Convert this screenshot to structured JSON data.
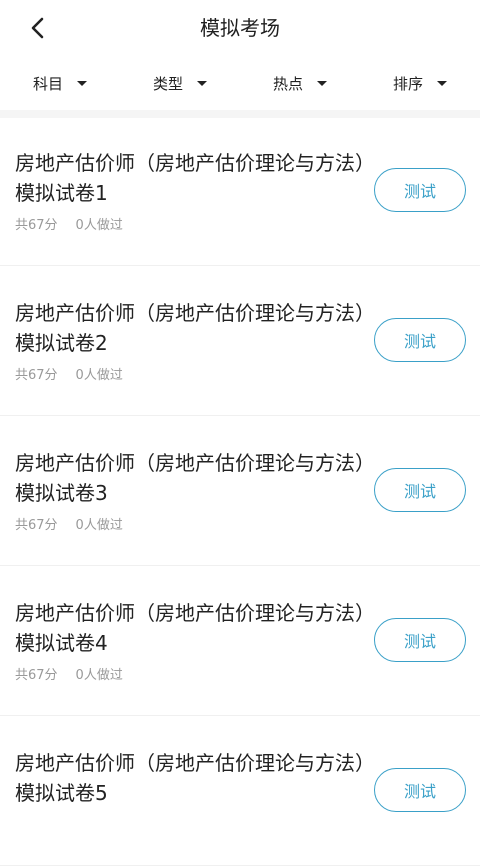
{
  "header": {
    "title": "模拟考场"
  },
  "filters": [
    {
      "label": "科目"
    },
    {
      "label": "类型"
    },
    {
      "label": "热点"
    },
    {
      "label": "排序"
    }
  ],
  "exams": [
    {
      "title": "房地产估价师（房地产估价理论与方法）模拟试卷1",
      "score": "共67分",
      "participants": "0人做过",
      "button": "测试"
    },
    {
      "title": "房地产估价师（房地产估价理论与方法）模拟试卷2",
      "score": "共67分",
      "participants": "0人做过",
      "button": "测试"
    },
    {
      "title": "房地产估价师（房地产估价理论与方法）模拟试卷3",
      "score": "共67分",
      "participants": "0人做过",
      "button": "测试"
    },
    {
      "title": "房地产估价师（房地产估价理论与方法）模拟试卷4",
      "score": "共67分",
      "participants": "0人做过",
      "button": "测试"
    },
    {
      "title": "房地产估价师（房地产估价理论与方法）模拟试卷5",
      "score": "",
      "participants": "",
      "button": "测试"
    }
  ],
  "colors": {
    "accent": "#3aa0c8",
    "meta_text": "#999999",
    "divider": "#f5f5f5"
  }
}
